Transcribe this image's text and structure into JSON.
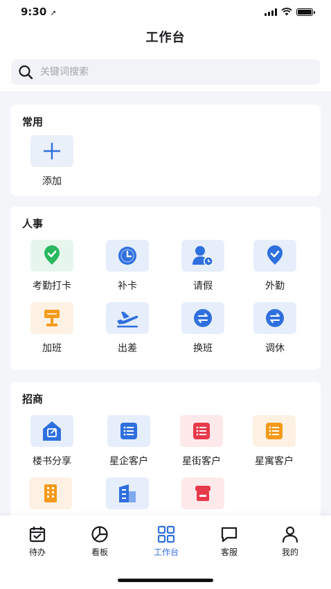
{
  "status_bar": {
    "time": "9:30"
  },
  "header": {
    "title": "工作台"
  },
  "search": {
    "placeholder": "关键词搜索"
  },
  "sections": {
    "common": {
      "title": "常用",
      "items": [
        {
          "label": "添加"
        }
      ]
    },
    "hr": {
      "title": "人事",
      "items": [
        {
          "label": "考勤打卡"
        },
        {
          "label": "补卡"
        },
        {
          "label": "请假"
        },
        {
          "label": "外勤"
        },
        {
          "label": "加班"
        },
        {
          "label": "出差"
        },
        {
          "label": "换班"
        },
        {
          "label": "调休"
        }
      ]
    },
    "investment": {
      "title": "招商",
      "items": [
        {
          "label": "楼书分享"
        },
        {
          "label": "星企客户"
        },
        {
          "label": "星街客户"
        },
        {
          "label": "星寓客户"
        }
      ]
    }
  },
  "tabbar": {
    "active_color": "#2f6fde",
    "items": [
      {
        "label": "待办"
      },
      {
        "label": "看板"
      },
      {
        "label": "工作台"
      },
      {
        "label": "客服"
      },
      {
        "label": "我的"
      }
    ]
  }
}
